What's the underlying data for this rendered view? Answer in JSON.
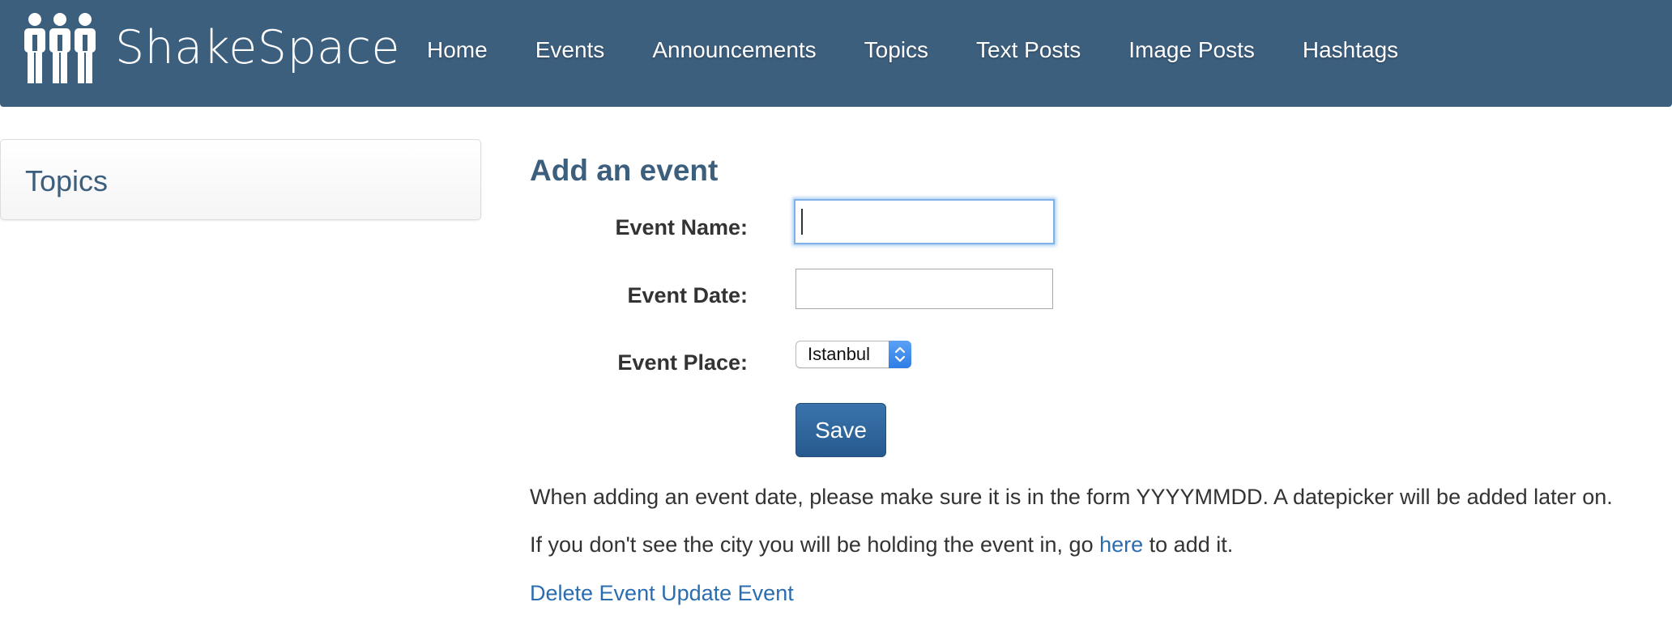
{
  "navbar": {
    "brand_name": "ShakeSpace",
    "brand_icon": "people-group-icon",
    "links": [
      "Home",
      "Events",
      "Announcements",
      "Topics",
      "Text Posts",
      "Image Posts",
      "Hashtags"
    ],
    "background_color": "#3d5f7e"
  },
  "sidebar": {
    "title": "Topics"
  },
  "form": {
    "title": "Add an event",
    "event_name_label": "Event Name:",
    "event_name_value": "",
    "event_date_label": "Event Date:",
    "event_date_value": "",
    "event_place_label": "Event Place:",
    "event_place_selected": "Istanbul",
    "save_label": "Save"
  },
  "help": {
    "date_note": "When adding an event date, please make sure it is in the form YYYYMMDD. A datepicker will be added later on.",
    "city_note_before": "If you don't see the city you will be holding the event in, go ",
    "city_note_link": "here",
    "city_note_after": " to add it.",
    "delete_link": "Delete Event",
    "update_link": "Update Event"
  },
  "colors": {
    "accent": "#3d5f7e",
    "link": "#2a6db0",
    "button": "#2e6699"
  }
}
